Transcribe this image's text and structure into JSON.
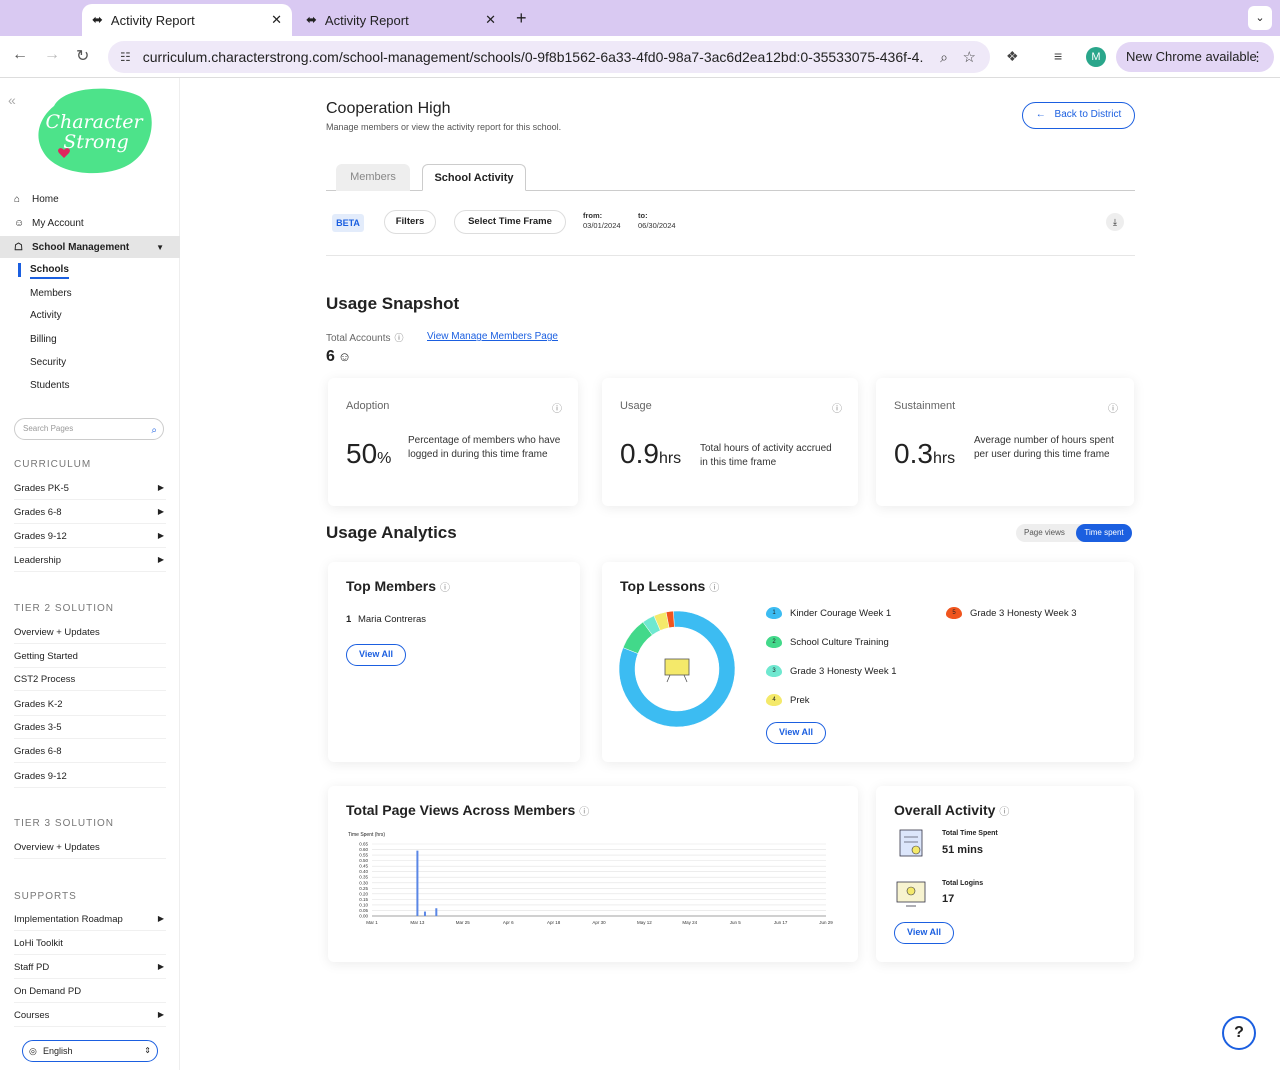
{
  "browser": {
    "tabs": [
      {
        "label": "Activity Report",
        "active": true
      },
      {
        "label": "Activity Report",
        "active": false
      }
    ],
    "url": "curriculum.characterstrong.com/school-management/schools/0-9f8b1562-6a33-4fd0-98a7-3ac6d2ea12bd:0-35533075-436f-4...",
    "profile_initial": "M",
    "update_label": "New Chrome available"
  },
  "sidebar": {
    "nav": [
      {
        "label": "Home",
        "icon": "home-icon"
      },
      {
        "label": "My Account",
        "icon": "user-icon"
      },
      {
        "label": "School Management",
        "icon": "building-icon"
      }
    ],
    "sub_items": [
      "Schools",
      "Members",
      "Activity",
      "Billing",
      "Security",
      "Students"
    ],
    "search_placeholder": "Search Pages",
    "sections": [
      {
        "title": "CURRICULUM",
        "items": [
          {
            "label": "Grades PK-5",
            "arrow": true
          },
          {
            "label": "Grades 6-8",
            "arrow": true
          },
          {
            "label": "Grades 9-12",
            "arrow": true
          },
          {
            "label": "Leadership",
            "arrow": true
          }
        ]
      },
      {
        "title": "TIER 2 SOLUTION",
        "items": [
          {
            "label": "Overview + Updates",
            "arrow": false
          },
          {
            "label": "Getting Started",
            "arrow": false
          },
          {
            "label": "CST2 Process",
            "arrow": false
          },
          {
            "label": "Grades K-2",
            "arrow": false
          },
          {
            "label": "Grades 3-5",
            "arrow": false
          },
          {
            "label": "Grades 6-8",
            "arrow": false
          },
          {
            "label": "Grades 9-12",
            "arrow": false
          }
        ]
      },
      {
        "title": "TIER 3 SOLUTION",
        "items": [
          {
            "label": "Overview + Updates",
            "arrow": false
          }
        ]
      },
      {
        "title": "SUPPORTS",
        "items": [
          {
            "label": "Implementation Roadmap",
            "arrow": true
          },
          {
            "label": "LoHi Toolkit",
            "arrow": false
          },
          {
            "label": "Staff PD",
            "arrow": true
          },
          {
            "label": "On Demand PD",
            "arrow": false
          },
          {
            "label": "Courses",
            "arrow": true
          }
        ]
      }
    ],
    "language": "English"
  },
  "header": {
    "title": "Cooperation High",
    "subtitle": "Manage members or view the activity report for this school.",
    "back_label": "Back to District",
    "tabs": [
      "Members",
      "School Activity"
    ],
    "beta": "BETA",
    "filters_label": "Filters",
    "timeframe_label": "Select Time Frame",
    "from_label": "from:",
    "from_value": "03/01/2024",
    "to_label": "to:",
    "to_value": "06/30/2024"
  },
  "snapshot": {
    "title": "Usage Snapshot",
    "total_accounts_label": "Total Accounts",
    "view_members_link": "View Manage Members Page",
    "total_accounts": "6",
    "cards": [
      {
        "label": "Adoption",
        "value": "50",
        "unit": "%",
        "desc": "Percentage of members who have logged in during this time frame"
      },
      {
        "label": "Usage",
        "value": "0.9",
        "unit": "hrs",
        "desc": "Total hours of activity accrued in this time frame"
      },
      {
        "label": "Sustainment",
        "value": "0.3",
        "unit": "hrs",
        "desc": "Average number of hours spent per user during this time frame"
      }
    ]
  },
  "analytics": {
    "title": "Usage Analytics",
    "toggle": [
      "Page views",
      "Time spent"
    ],
    "top_members": {
      "title": "Top Members",
      "items": [
        {
          "rank": "1",
          "name": "Maria Contreras"
        }
      ],
      "view_all": "View All"
    },
    "top_lessons": {
      "title": "Top Lessons",
      "items": [
        {
          "rank": "1",
          "name": "Kinder Courage Week 1",
          "color": "#3cbcf2"
        },
        {
          "rank": "2",
          "name": "School Culture Training",
          "color": "#42d98a"
        },
        {
          "rank": "3",
          "name": "Grade 3 Honesty Week 1",
          "color": "#6fe8d0"
        },
        {
          "rank": "4",
          "name": "Prek",
          "color": "#f4e96a"
        },
        {
          "rank": "5",
          "name": "Grade 3 Honesty Week 3",
          "color": "#f0551e"
        }
      ],
      "view_all": "View All"
    },
    "page_views": {
      "title": "Total Page Views Across Members"
    },
    "overall": {
      "title": "Overall Activity",
      "time_label": "Total Time Spent",
      "time_value": "51 mins",
      "logins_label": "Total Logins",
      "logins_value": "17",
      "view_all": "View All"
    }
  },
  "chart_data": [
    {
      "type": "pie",
      "title": "",
      "categories": [
        "Kinder Courage Week 1",
        "School Culture Training",
        "Grade 3 Honesty Week 1",
        "Prek",
        "Grade 3 Honesty Week 3"
      ],
      "values": [
        82,
        9,
        3.5,
        3.5,
        2
      ],
      "colors": [
        "#3cbcf2",
        "#42d98a",
        "#6fe8d0",
        "#f4e96a",
        "#f0551e"
      ]
    },
    {
      "type": "bar",
      "title": "",
      "ylabel": "Time Spent (hrs)",
      "ylim": [
        0,
        0.65
      ],
      "yticks": [
        "0.00",
        "0.05",
        "0.10",
        "0.15",
        "0.20",
        "0.25",
        "0.30",
        "0.35",
        "0.40",
        "0.45",
        "0.50",
        "0.55",
        "0.60",
        "0.65"
      ],
      "xticks": [
        "Mar 1",
        "Mar 13",
        "Mar 25",
        "Apr 6",
        "Apr 18",
        "Apr 30",
        "May 12",
        "May 24",
        "Jun 5",
        "Jun 17",
        "Jun 29"
      ],
      "x": [
        "2024-03-13",
        "2024-03-15",
        "2024-03-18"
      ],
      "values": [
        0.59,
        0.04,
        0.07
      ]
    }
  ]
}
